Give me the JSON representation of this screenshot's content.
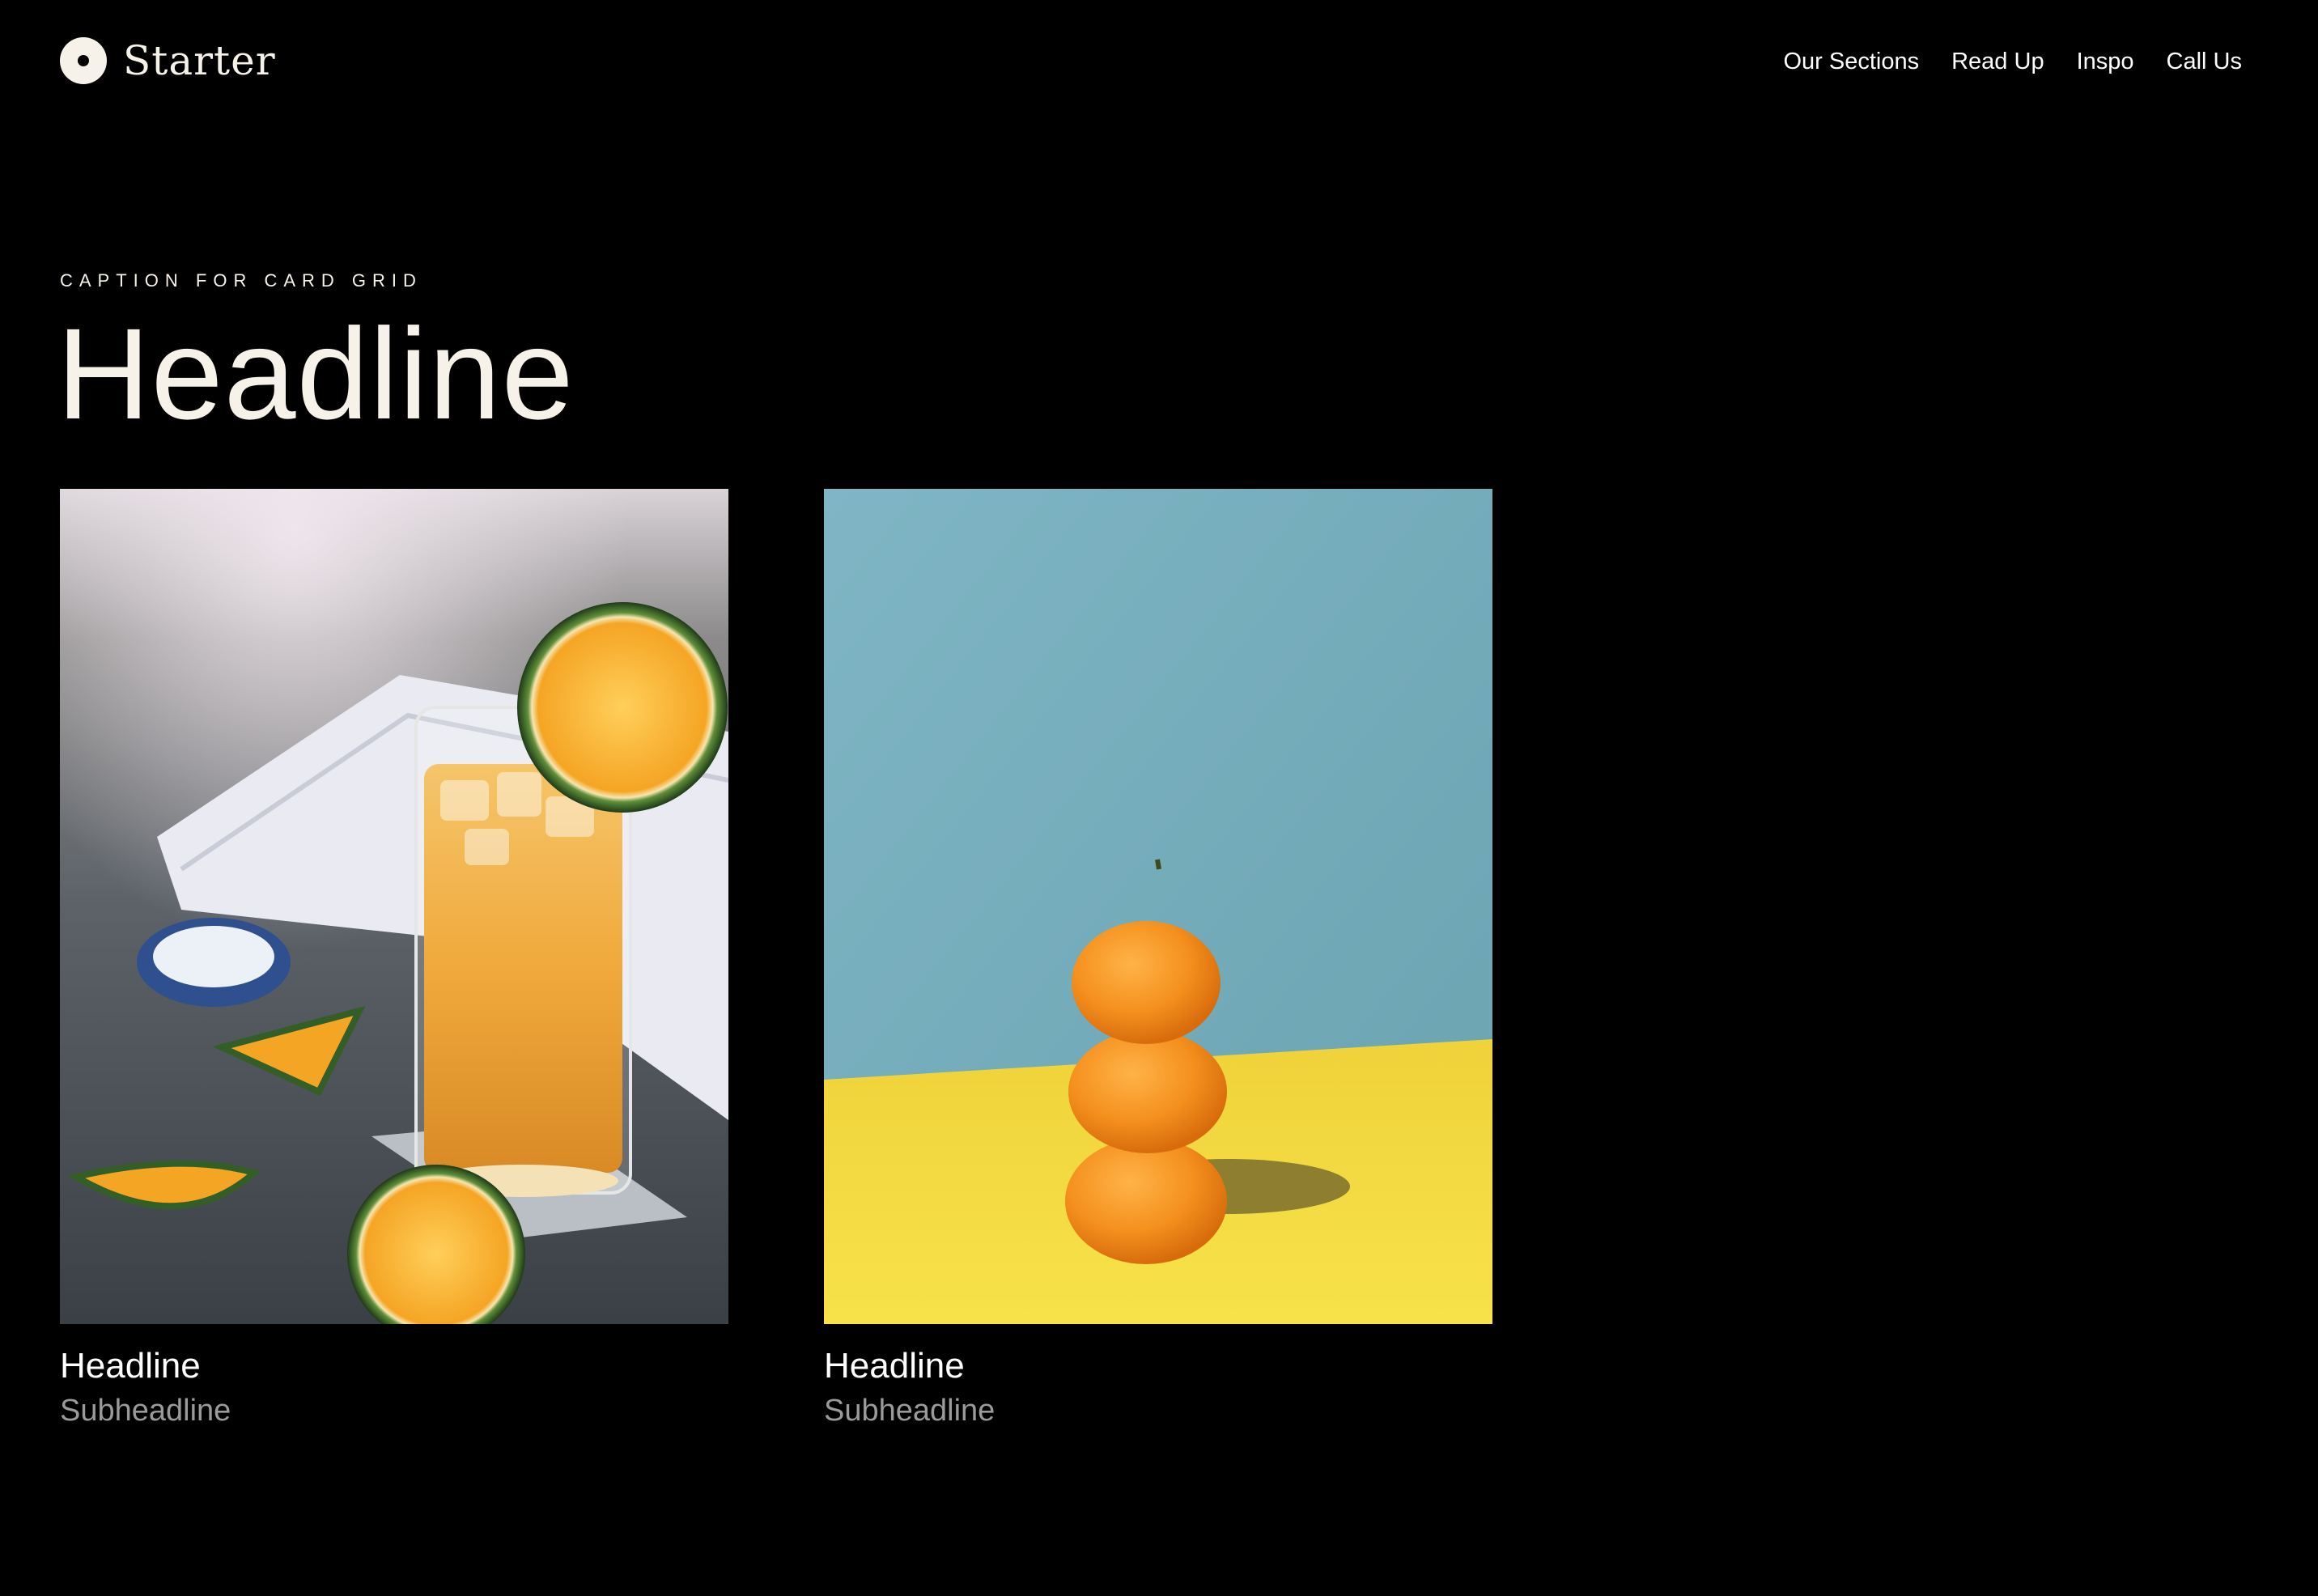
{
  "brand": {
    "name": "Starter",
    "logo_icon": "circle-dot-icon"
  },
  "nav": {
    "items": [
      {
        "label": "Our Sections"
      },
      {
        "label": "Read Up"
      },
      {
        "label": "Inspo"
      },
      {
        "label": "Call Us"
      }
    ]
  },
  "section": {
    "caption": "CAPTION FOR CARD GRID",
    "headline": "Headline"
  },
  "cards": [
    {
      "image": "iced-citrus-drink-photo",
      "title": "Headline",
      "subtitle": "Subheadline"
    },
    {
      "image": "stacked-tangerines-photo",
      "title": "Headline",
      "subtitle": "Subheadline"
    }
  ],
  "colors": {
    "background": "#000000",
    "text": "#f6f1e9",
    "subtitle": "#9a9a9a"
  }
}
